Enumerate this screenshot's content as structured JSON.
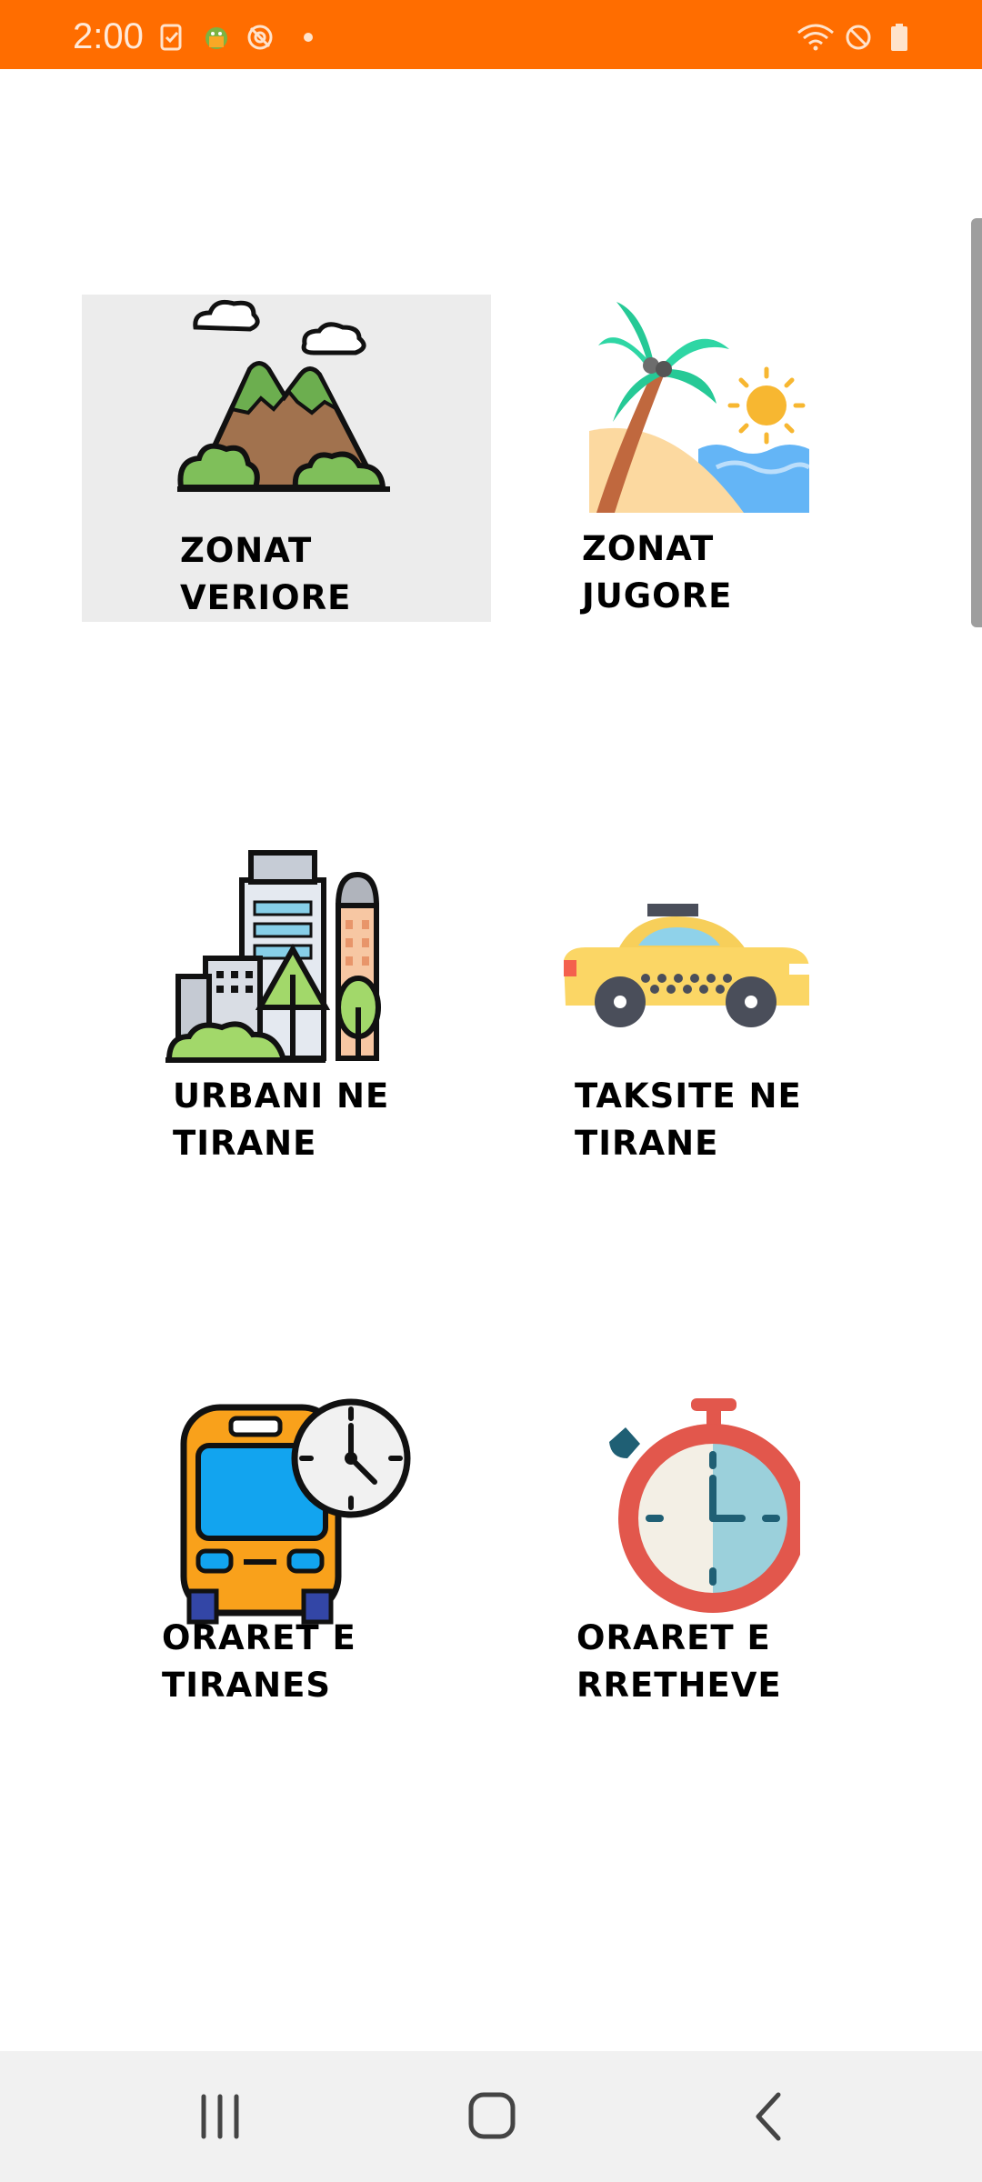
{
  "status_bar": {
    "time": "2:00",
    "background": "#FF6D00",
    "left_icons": [
      "tasks-icon",
      "android-debug-icon",
      "sync-off-icon",
      "dot-icon"
    ],
    "right_icons": [
      "wifi-icon",
      "do-not-disturb-icon",
      "battery-icon"
    ]
  },
  "tiles": [
    {
      "id": "zonat-veriore",
      "label": "ZONAT\nVERIORE",
      "icon": "mountains-icon",
      "selected": true
    },
    {
      "id": "zonat-jugore",
      "label": "ZONAT\nJUGORE",
      "icon": "beach-palm-icon",
      "selected": false
    },
    {
      "id": "urbani-ne-tirane",
      "label": "URBANI NE\nTIRANE",
      "icon": "city-buildings-icon",
      "selected": false
    },
    {
      "id": "taksite-ne-tirane",
      "label": "TAKSITE NE\nTIRANE",
      "icon": "taxi-icon",
      "selected": false
    },
    {
      "id": "oraret-e-tiranes",
      "label": "ORARET E\nTIRANES",
      "icon": "bus-clock-icon",
      "selected": false
    },
    {
      "id": "oraret-e-rretheve",
      "label": "ORARET E\n RRETHEVE",
      "icon": "stopwatch-icon",
      "selected": false
    }
  ],
  "nav_bar": {
    "buttons": [
      "recents-icon",
      "home-icon",
      "back-icon"
    ]
  }
}
